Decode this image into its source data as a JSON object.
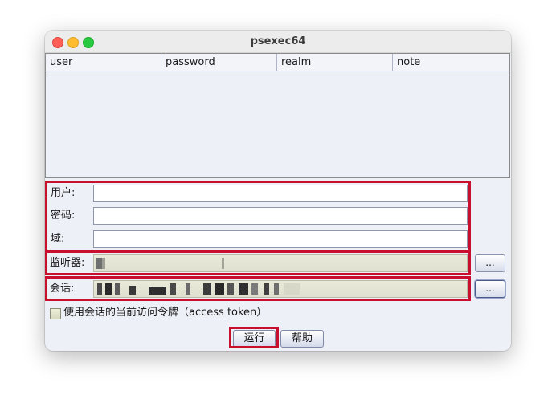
{
  "window": {
    "title": "psexec64"
  },
  "table": {
    "columns": [
      "user",
      "password",
      "realm",
      "note"
    ]
  },
  "form": {
    "user_label": "用户:",
    "password_label": "密码:",
    "domain_label": "域:",
    "listener_label": "监听器:",
    "session_label": "会话:",
    "listener_browse": "...",
    "session_browse": "...",
    "token_checkbox_label": "使用会话的当前访问令牌（access token）",
    "token_checked": false
  },
  "buttons": {
    "run": "运行",
    "help": "帮助"
  },
  "colors": {
    "highlight": "#c8102e"
  }
}
